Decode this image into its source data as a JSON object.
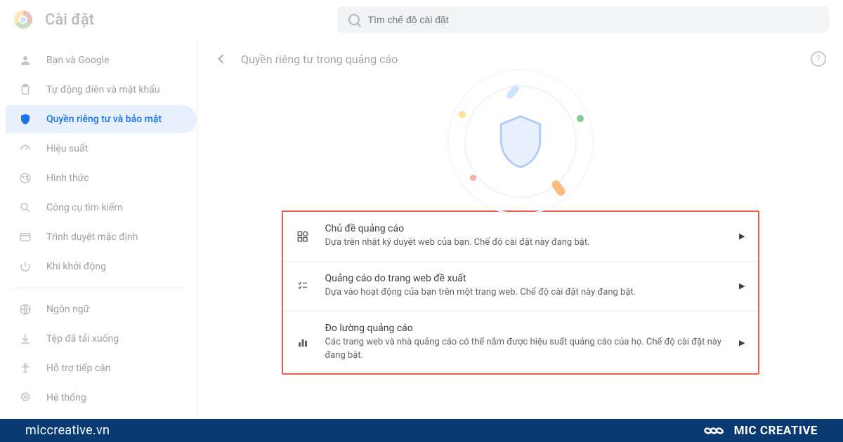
{
  "header": {
    "title": "Cài đặt",
    "search_placeholder": "Tìm chế độ cài đặt"
  },
  "sidebar": {
    "items": [
      {
        "label": "Bạn và Google",
        "icon": "person"
      },
      {
        "label": "Tự động điền và mật khẩu",
        "icon": "clipboard"
      },
      {
        "label": "Quyền riêng tư và bảo mật",
        "icon": "shield",
        "active": true
      },
      {
        "label": "Hiệu suất",
        "icon": "speed"
      },
      {
        "label": "Hình thức",
        "icon": "palette"
      },
      {
        "label": "Công cụ tìm kiếm",
        "icon": "search"
      },
      {
        "label": "Trình duyệt mặc định",
        "icon": "browser"
      },
      {
        "label": "Khi khởi động",
        "icon": "power"
      }
    ],
    "items2": [
      {
        "label": "Ngôn ngữ",
        "icon": "globe"
      },
      {
        "label": "Tệp đã tải xuống",
        "icon": "download"
      },
      {
        "label": "Hỗ trợ tiếp cận",
        "icon": "accessibility"
      },
      {
        "label": "Hệ thống",
        "icon": "system"
      }
    ]
  },
  "main": {
    "title": "Quyền riêng tư trong quảng cáo",
    "rows": [
      {
        "title": "Chủ đề quảng cáo",
        "desc": "Dựa trên nhật ký duyệt web của bạn. Chế độ cài đặt này đang bật.",
        "icon": "topics"
      },
      {
        "title": "Quảng cáo do trang web đề xuất",
        "desc": "Dựa vào hoạt động của bạn trên một trang web. Chế độ cài đặt này đang bật.",
        "icon": "suggested"
      },
      {
        "title": "Đo lường quảng cáo",
        "desc": "Các trang web và nhà quảng cáo có thể nắm được hiệu suất quảng cáo của họ. Chế độ cài đặt này đang bật.",
        "icon": "measure"
      }
    ]
  },
  "footer": {
    "url": "miccreative.vn",
    "brand": "MIC CREATIVE"
  }
}
